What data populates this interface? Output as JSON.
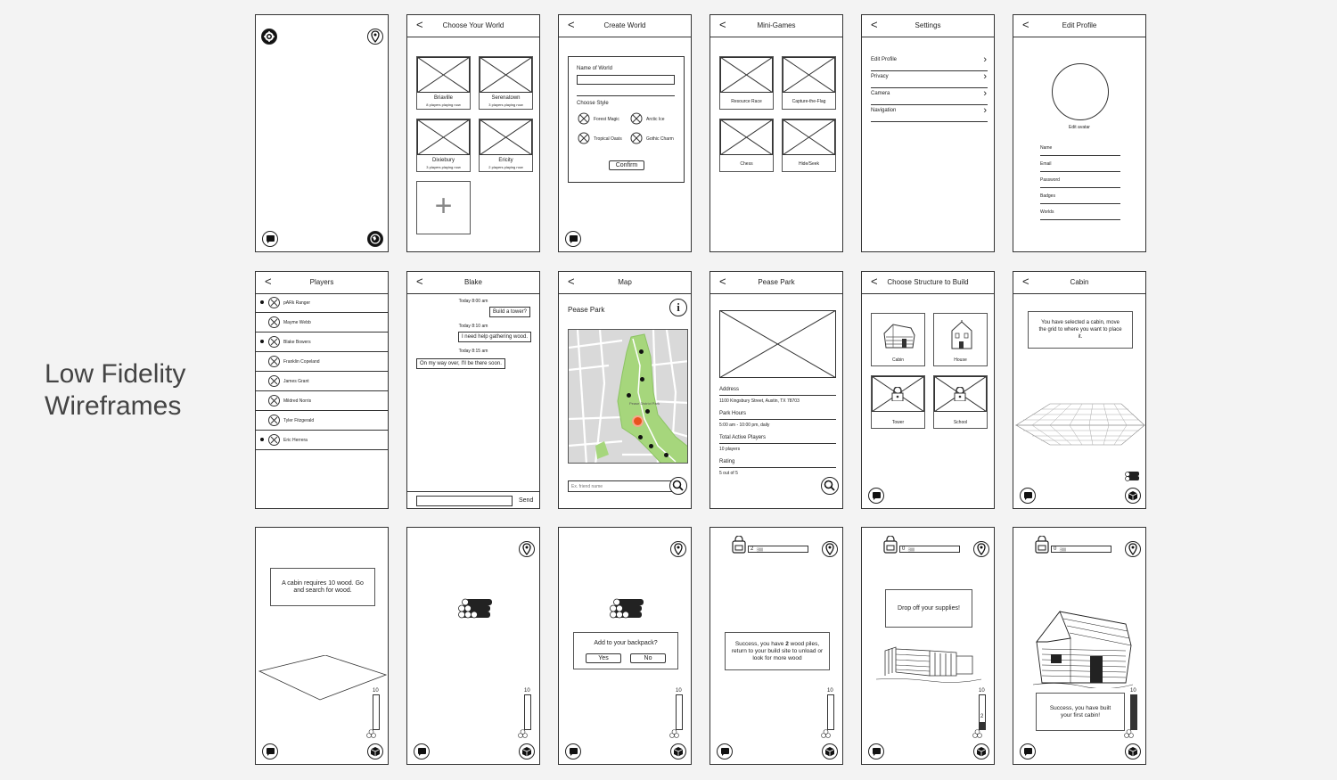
{
  "heading": {
    "line1": "Low Fidelity",
    "line2": "Wireframes"
  },
  "common": {
    "back_glyph": "<"
  },
  "home": {},
  "choose_world": {
    "title": "Choose Your World",
    "worlds": [
      {
        "name": "Briaville",
        "players": "8 players playing now"
      },
      {
        "name": "Serenatown",
        "players": "3 players playing now"
      },
      {
        "name": "Dixiebury",
        "players": "3 players playing now"
      },
      {
        "name": "Ericity",
        "players": "2 players playing now"
      }
    ],
    "add_glyph": "+"
  },
  "create_world": {
    "title": "Create World",
    "name_label": "Name of World",
    "style_label": "Choose Style",
    "styles": [
      "Forest Magic",
      "Arctic Ice",
      "Tropical Oasis",
      "Gothic Charm"
    ],
    "confirm_label": "Confirm"
  },
  "mini_games": {
    "title": "Mini-Games",
    "games": [
      "Resource Race",
      "Capture-the-Flag",
      "Chess",
      "Hide/Seek"
    ]
  },
  "settings": {
    "title": "Settings",
    "items": [
      "Edit Profile",
      "Privacy",
      "Camera",
      "Navigation"
    ]
  },
  "edit_profile": {
    "title": "Edit Profile",
    "avatar_label": "Edit avatar",
    "fields": [
      "Name",
      "Email",
      "Password",
      "Badges",
      "Worlds"
    ]
  },
  "players": {
    "title": "Players",
    "list": [
      {
        "name": "pARk Ranger",
        "online": true
      },
      {
        "name": "Mayme Webb",
        "online": false
      },
      {
        "name": "Blake Bowers",
        "online": true
      },
      {
        "name": "Franklin Copeland",
        "online": false
      },
      {
        "name": "James Grant",
        "online": false
      },
      {
        "name": "Mildred Norris",
        "online": false
      },
      {
        "name": "Tyler Fitzgerald",
        "online": false
      },
      {
        "name": "Eric Herrera",
        "online": true
      }
    ]
  },
  "chat": {
    "title": "Blake",
    "messages": [
      {
        "time": "Today 8:00 am",
        "text": "Build a tower?"
      },
      {
        "time": "Today 8:10 am",
        "text": "I need help gathering wood."
      },
      {
        "time": "Today 8:15 am",
        "text": "On my way over, I'll be there soon."
      }
    ],
    "send_label": "Send"
  },
  "map": {
    "title": "Map",
    "place": "Pease Park",
    "info_glyph": "i",
    "search_placeholder": "Ex. friend name",
    "map_label": "Pease District Park",
    "colors": {
      "park": "#a6d67c",
      "road": "#ffffff",
      "ground": "#d9d9d9",
      "you": "#e8531f"
    }
  },
  "pease_park": {
    "title": "Pease Park",
    "address_label": "Address",
    "address": "1100 Kingsbury Street, Austin, TX 78703",
    "hours_label": "Park Hours",
    "hours": "5:00 am - 10:00 pm, daily",
    "players_label": "Total Active Players",
    "players": "10 players",
    "rating_label": "Rating",
    "rating": "5 out of 5"
  },
  "choose_structure": {
    "title": "Choose Structure to Build",
    "structures": [
      "Cabin",
      "House",
      "Tower",
      "School"
    ]
  },
  "cabin": {
    "title": "Cabin",
    "message": "You have selected a cabin, move the grid to where you want to place it."
  },
  "bottom": {
    "requires": "A cabin requires 10 wood. Go and search for wood.",
    "backpack_question": "Add to your backpack?",
    "yes_label": "Yes",
    "no_label": "No",
    "success_pre": "Success, you have ",
    "success_count": "2",
    "success_post": " wood piles, return to your build site to unload or look for more wood",
    "drop_off": "Drop off your supplies!",
    "built": "Success, you have built your first cabin!",
    "meter_max": "10",
    "meter_two": "2",
    "pack_count_2": "2",
    "pack_count_0a": "0",
    "pack_count_0b": "0",
    "wood_level": {
      "s13": 0,
      "s14": 0,
      "s15": 0,
      "s16": 0,
      "s17": 0.2,
      "s18": 1.0
    }
  }
}
